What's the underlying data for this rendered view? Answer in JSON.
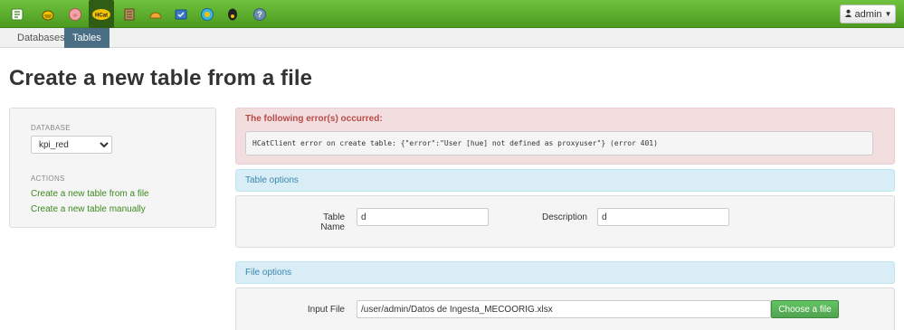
{
  "topbar": {
    "apps": [
      {
        "name": "hue-home-icon",
        "color": "#ffffff",
        "active": false
      },
      {
        "name": "beeswax-icon",
        "color": "#f5c400",
        "active": false
      },
      {
        "name": "pig-icon",
        "color": "#f4a3a8",
        "active": false
      },
      {
        "name": "hcatalog-icon",
        "color": "#f5c400",
        "active": true,
        "text": "HCat"
      },
      {
        "name": "file-browser-icon",
        "color": "#8b6b3d",
        "active": false
      },
      {
        "name": "job-designer-icon",
        "color": "#f0a830",
        "active": false
      },
      {
        "name": "job-browser-icon",
        "color": "#3b78c8",
        "active": false
      },
      {
        "name": "oozie-icon",
        "color": "#3fb5e6",
        "active": false
      },
      {
        "name": "shell-icon",
        "color": "#222222",
        "active": false
      },
      {
        "name": "help-icon",
        "color": "#6c8fb0",
        "active": false
      }
    ],
    "user_label": "admin"
  },
  "subnav": {
    "tabs": [
      {
        "label": "Databases",
        "active": false
      },
      {
        "label": "Tables",
        "active": true
      }
    ]
  },
  "page": {
    "title": "Create a new table from a file"
  },
  "sidebar": {
    "database_header": "DATABASE",
    "database_selected": "kpi_red",
    "actions_header": "ACTIONS",
    "actions": [
      {
        "label": "Create a new table from a file"
      },
      {
        "label": "Create a new table manually"
      }
    ]
  },
  "error": {
    "title": "The following error(s) occurred:",
    "message": "HCatClient error on create table: {\"error\":\"User [hue] not defined as proxyuser\"} (error 401)"
  },
  "table_options": {
    "heading": "Table options",
    "name_label": "Table Name",
    "name_value": "d",
    "description_label": "Description",
    "description_value": "d"
  },
  "file_options": {
    "heading": "File options",
    "input_label": "Input File",
    "input_value": "/user/admin/Datos de Ingesta_MECOORIG.xlsx",
    "choose_label": "Choose a file"
  },
  "colors": {
    "topbar_green": "#5aa82c",
    "link_green": "#3d8a1f",
    "error_red": "#b94a48",
    "info_blue": "#3a87ad"
  }
}
